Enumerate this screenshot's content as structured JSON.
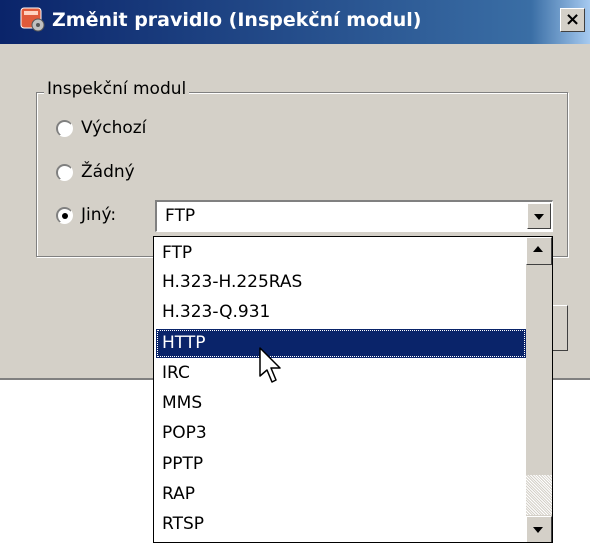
{
  "window": {
    "title": "Změnit pravidlo (Inspekční modul)",
    "close_glyph": "×"
  },
  "group": {
    "legend": "Inspekční modul",
    "options": [
      {
        "label": "Výchozí",
        "checked": false
      },
      {
        "label": "Žádný",
        "checked": false
      },
      {
        "label": "Jiný:",
        "checked": true
      }
    ]
  },
  "select": {
    "value": "FTP"
  },
  "dropdown": {
    "items": [
      "FTP",
      "H.323-H.225RAS",
      "H.323-Q.931",
      "HTTP",
      "IRC",
      "MMS",
      "POP3",
      "PPTP",
      "RAP",
      "RTSP"
    ],
    "highlighted": "HTTP"
  },
  "colors": {
    "titlebar": "#0a246a",
    "dialog_bg": "#d4d0c8",
    "selection": "#0a246a"
  }
}
